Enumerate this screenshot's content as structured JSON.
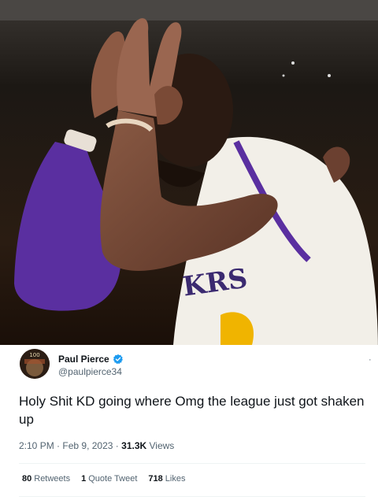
{
  "tweet": {
    "display_name": "Paul Pierce",
    "handle": "@paulpierce34",
    "text": "Holy Shit KD going where Omg the league just got shaken up",
    "time": "2:10 PM",
    "separator": "·",
    "date": "Feb 9, 2023",
    "views_count": "31.3K",
    "views_label": "Views",
    "more_label": "·",
    "verified_color": "#1d9bf0"
  },
  "avatar": {
    "text": "100"
  },
  "media": {
    "jersey_text": "KRS"
  },
  "stats": {
    "retweets_count": "80",
    "retweets_label": "Retweets",
    "quotes_count": "1",
    "quotes_label": "Quote Tweet",
    "likes_count": "718",
    "likes_label": "Likes"
  }
}
